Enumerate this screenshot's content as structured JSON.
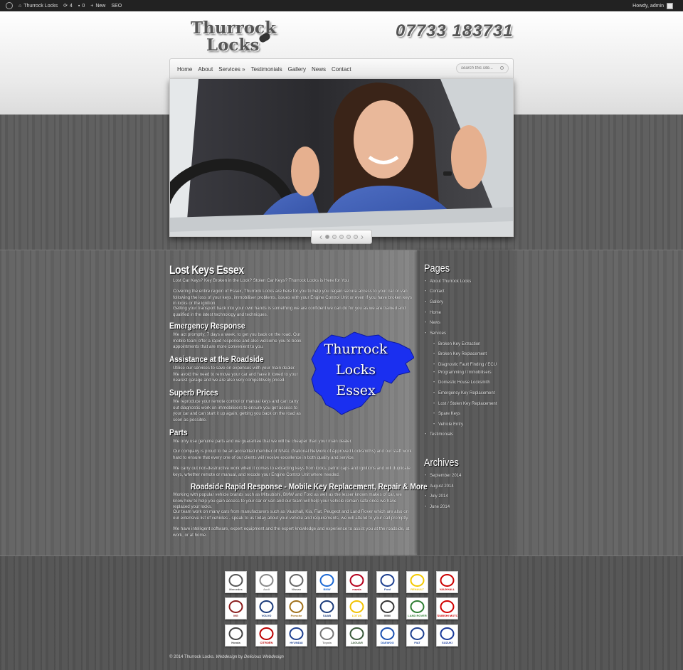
{
  "adminbar": {
    "site_name": "Thurrock Locks",
    "updates": "4",
    "comments": "0",
    "new": "New",
    "seo": "SEO",
    "howdy": "Howdy, admin"
  },
  "header": {
    "logo_line1": "Thurrock",
    "logo_line2": "Locks",
    "phone": "07733 183731"
  },
  "nav": {
    "items": [
      "Home",
      "About",
      "Services »",
      "Testimonials",
      "Gallery",
      "News",
      "Contact"
    ],
    "search_placeholder": "search this site..."
  },
  "content": {
    "title": "Lost Keys Essex",
    "intro": "Lost Car Keys? Key Broken in the Lock? Stolen Car Keys? Thurrock Locks is Here for You",
    "p1": "Covering the entire region of Essex, Thurrock Locks are here for you to help you regain secure access to your car or van following the loss of your keys, immobiliser problems, issues with your Engine Control Unit or even if you have broken keys in locks or the ignition.",
    "p2": "Getting your transport back into your own hands is something we are confident we can do for you as we are trained and qualified in the latest technology and techniques.",
    "h_emergency": "Emergency Response",
    "p_emergency": "We act promptly, 7 days a week, to get you back on the road. Our mobile team offer a rapid response and also welcome you to book appointments that are more convenient to you.",
    "h_roadside": "Assistance at the Roadside",
    "p_roadside": "Utilise our services to save on expenses with your main dealer. We avoid the need to remove your car and have it towed to your nearest garage and we are also very competitively priced.",
    "h_prices": "Superb Prices",
    "p_prices": "We reproduce your remote control or manual keys and can carry out diagnostic work on immobilisers to ensure you get access to your car and can start it up again, getting you back on the road as soon as possible.",
    "h_parts": "Parts",
    "p_parts1": "We only use genuine parts and we guarantee that we will be cheaper than your main dealer.",
    "p_parts2": "Our company is proud to be an accredited member of NNAL (National Network of Approved Locksmiths) and our staff work hard to ensure that every one of our clients will receive excellence in both quality and service.",
    "p_parts3": "We carry out non-destructive work when it comes to extracting keys from locks, petrol caps and ignitions and will duplicate keys, whether remote or manual, and recode your Engine Control Unit where needed.",
    "h_rapid": "Roadside Rapid Response - Mobile Key Replacement, Repair & More",
    "p_rapid1": "Working with popular vehicle brands such as Mitsubishi, BMW and Ford as well as the lesser known makes of car, we know how to help you gain access to your car or van and our team will help your vehicle remain safe once we have replaced your locks.",
    "p_rapid2": "Our team work on many cars from manufacturers such as Vauxhall, Kia, Fiat, Peugeot and Land Rover which are also on our extensive list of vehicles - speak to us today about your vehicle and requirements, we will attend to your call promptly.",
    "p_rapid3": "We have intelligent software, expert equipment and the expert knowledge and experience to assist you at the roadside, at work, or at home.",
    "map_line1": "Thurrock",
    "map_line2": "Locks",
    "map_line3": "Essex"
  },
  "sidebar": {
    "pages_title": "Pages",
    "pages": [
      "About Thurrock Locks",
      "Contact",
      "Gallery",
      "Home",
      "News",
      "Services"
    ],
    "services": [
      "Broken Key Extraction",
      "Broken Key Replacement",
      "Diagnostic Fault Finding / ECU",
      "Programming / Immobilisers",
      "Domestic House Locksmith",
      "Emergency Key Replacement",
      "Lost / Stolen Key Replacement",
      "Spare Keys",
      "Vehicle Entry"
    ],
    "testimonials": "Testimonials",
    "archives_title": "Archives",
    "archives": [
      "September 2014",
      "August 2014",
      "July 2014",
      "June 2014"
    ]
  },
  "brands": [
    "Mercedes",
    "Audi",
    "Nissan",
    "BMW",
    "mazda",
    "Ford",
    "RENAULT",
    "VAUXHALL",
    "MG",
    "VOLVO",
    "Porsche",
    "SAAB",
    "LOTUS",
    "MINI",
    "LAND ROVER",
    "MITSUBISHI MOTORS",
    "Honda",
    "CITROËN",
    "HYUNDAI",
    "Toyota",
    "JAGUAR",
    "DAEWOO",
    "FIAT",
    "SUZUKI"
  ],
  "footer": {
    "copyright": "© 2014 Thurrock Locks.",
    "webdesign": "Webdesign",
    "by": "by",
    "designer": "Delicious Webdesign"
  },
  "colors": {
    "map_blue": "#1a2ff0",
    "adminbar": "#222222",
    "wood": "#5d5d5d"
  }
}
